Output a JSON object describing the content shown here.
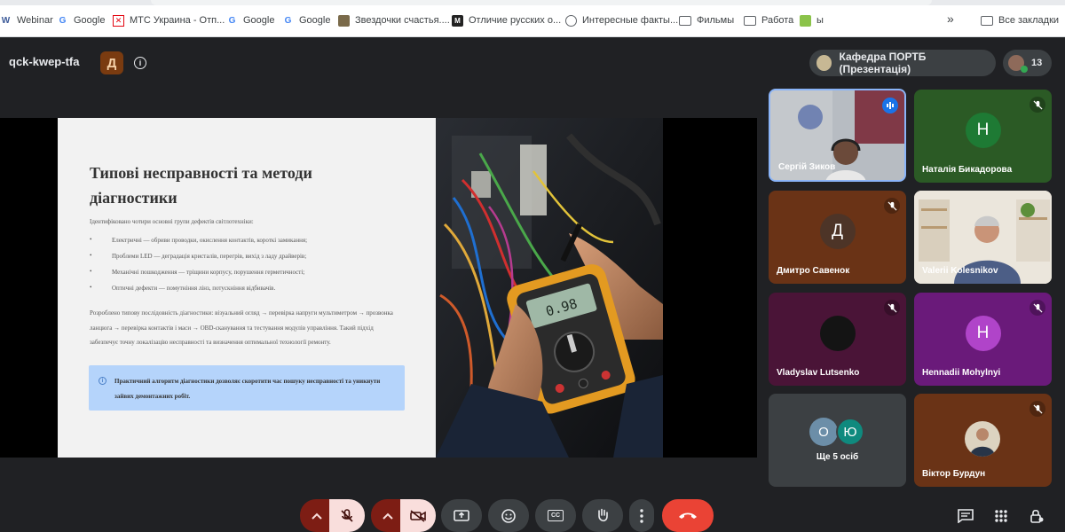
{
  "bookmarks": [
    {
      "label": "Webinar",
      "icon": "webinar-icon"
    },
    {
      "label": "Google",
      "icon": "google-icon"
    },
    {
      "label": "МТС Украина - Отп...",
      "icon": "mts-icon"
    },
    {
      "label": "Google",
      "icon": "google-icon"
    },
    {
      "label": "Google",
      "icon": "google-icon"
    },
    {
      "label": "Звездочки счастья....",
      "icon": "image-icon"
    },
    {
      "label": "Отличие русских о...",
      "icon": "m-icon"
    },
    {
      "label": "Интересные факты...",
      "icon": "globe-icon"
    },
    {
      "label": "Фильмы",
      "icon": "folder-icon"
    },
    {
      "label": "Работа",
      "icon": "folder-icon"
    },
    {
      "label": "ы",
      "icon": "basket-icon"
    }
  ],
  "bookmarks_overflow": "»",
  "all_bookmarks": "Все закладки",
  "meeting": {
    "code": "qck-kwep-tfa",
    "host_initial": "Д",
    "info_glyph": "i",
    "presentation_chip": "Кафедра ПОРТБ (Презентація)",
    "participants_count": "13"
  },
  "slide": {
    "title": "Типові несправності та методи діагностики",
    "intro": "Ідентифіковано чотири основні групи дефектів світлотехніки:",
    "bullets": [
      "Електричні — обриви проводки, окислення контактів, короткі замикання;",
      "Проблеми LED — деградація кристалів, перегрів, вихід з ладу драйверів;",
      "Механічні пошкодження — тріщини корпусу, порушення герметичності;",
      "Оптичні дефекти — помутніння лінз, потускніння відбивачів."
    ],
    "paragraph": "Розроблено типову послідовність діагностики: візуальний огляд → перевірка напруги мультиметром → прозвонка ланцюга → перевірка контактів і маси → OBD-сканування та тестування модулів управління. Такий підхід забезпечує точну локалізацію несправності та визначення оптимальної технології ремонту.",
    "callout": "Практичний алгоритм діагностики дозволяє скоротити час пошуку несправності та уникнути зайвих демонтажних робіт.",
    "callout_glyph": "i",
    "multimeter_reading": "0.98"
  },
  "participants": [
    {
      "name": "Сергій Зиков",
      "type": "video",
      "speaking": true,
      "muted": false
    },
    {
      "name": "Наталія Бикадорова",
      "initial": "Н",
      "bg": "#2b5a25",
      "avatar": "#1e7a34",
      "muted": true
    },
    {
      "name": "Дмитро Савенок",
      "initial": "Д",
      "bg": "#6a3316",
      "avatar": "#4d3427",
      "muted": true
    },
    {
      "name": "Valerii Kolesnikov",
      "type": "video",
      "muted": false
    },
    {
      "name": "Vladyslav Lutsenko",
      "initial": "",
      "bg": "#4a1437",
      "avatar": "#141414",
      "muted": true
    },
    {
      "name": "Hennadii Mohylnyi",
      "initial": "Н",
      "bg": "#6a1a7a",
      "avatar": "#b044c9",
      "muted": true
    },
    {
      "name": "Ще 5 осіб",
      "initials": [
        "О",
        "Ю"
      ],
      "bg": "#3c4043",
      "muted": false
    },
    {
      "name": "Віктор Бурдун",
      "bg": "#6a3316",
      "muted": true,
      "type": "photo"
    }
  ],
  "controls": {
    "mic_muted": true,
    "camera_off": true,
    "chevron": "^",
    "cc_label": "CC"
  },
  "colors": {
    "background": "#202124",
    "accent_blue": "#8ab4f8",
    "end_call": "#ea4335",
    "muted_btn": "#f9dedc",
    "muted_chevron": "#7d1d14"
  }
}
